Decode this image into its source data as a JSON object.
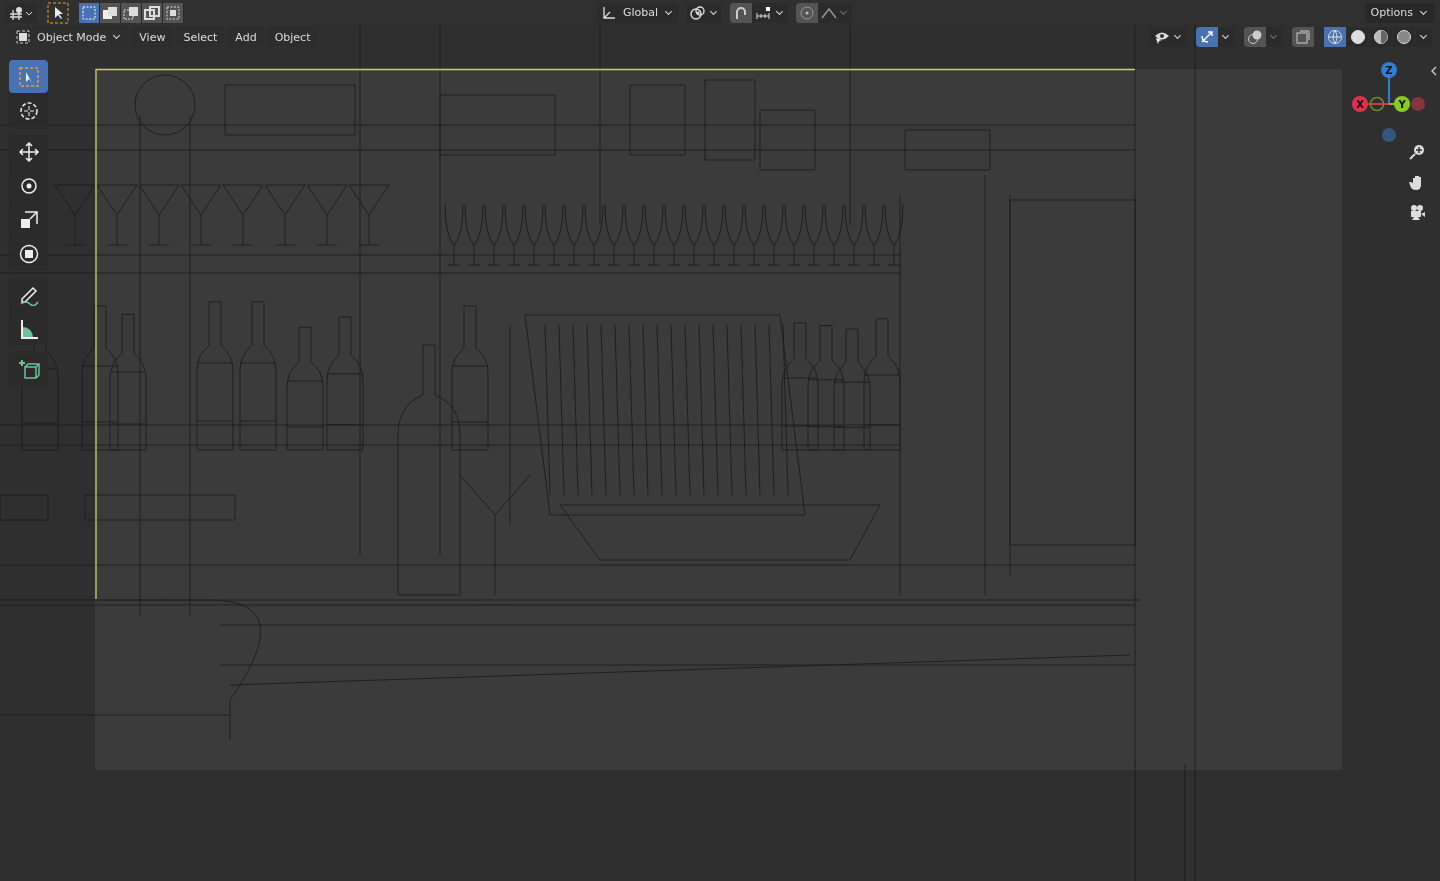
{
  "top_bar": {
    "select_modes": [
      {
        "selected": true
      },
      {
        "selected": false
      },
      {
        "selected": false
      },
      {
        "selected": false
      },
      {
        "selected": false
      }
    ],
    "transform_orientation": "Global",
    "snap": {
      "on": true
    },
    "options": "Options"
  },
  "viewport_header": {
    "mode": "Object Mode",
    "menus": [
      "View",
      "Select",
      "Add",
      "Object"
    ],
    "gizmos": {
      "on": true
    },
    "shading": [
      {
        "kind": "wireframe",
        "selected": true
      },
      {
        "kind": "solid",
        "selected": false
      },
      {
        "kind": "material",
        "selected": false
      },
      {
        "kind": "rendered",
        "selected": false
      }
    ]
  },
  "tools": [
    {
      "kind": "select",
      "selected": true
    },
    {
      "kind": "cursor",
      "selected": false
    },
    {
      "kind": "move",
      "selected": false
    },
    {
      "kind": "rotate",
      "selected": false
    },
    {
      "kind": "scale",
      "selected": false
    },
    {
      "kind": "transform",
      "selected": false
    },
    {
      "kind": "annotate",
      "selected": false
    },
    {
      "kind": "measure",
      "selected": false
    },
    {
      "kind": "add-cube",
      "selected": false
    }
  ],
  "navigation_gizmo": {
    "axes": [
      "Z",
      "X",
      "Y"
    ]
  }
}
